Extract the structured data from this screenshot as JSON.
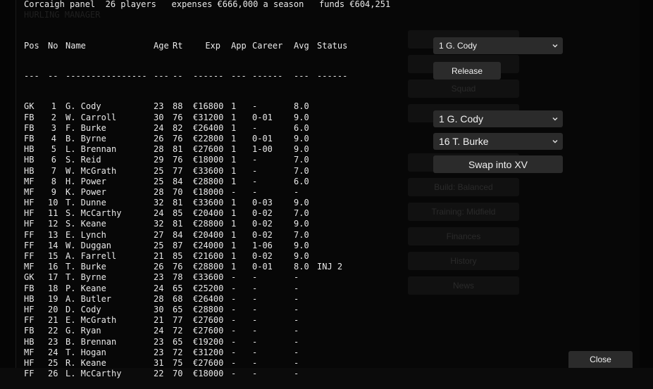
{
  "header": {
    "text": "Corcaigh panel  26 players   expenses €666,000 a season   funds €604,251"
  },
  "table": {
    "columns": {
      "pos": "Pos",
      "no": "No",
      "name": "Name",
      "age": "Age",
      "rt": "Rt",
      "exp": "Exp",
      "app": "App",
      "career": "Career",
      "avg": "Avg",
      "status": "Status"
    },
    "separator": {
      "pos": "---",
      "no": "--",
      "name": "----------------",
      "age": "---",
      "rt": "--",
      "exp": "------",
      "app": "---",
      "career": "------",
      "avg": "---",
      "status": "------"
    },
    "rows": [
      {
        "pos": "GK",
        "no": "1",
        "name": "G. Cody",
        "age": "23",
        "rt": "88",
        "exp": "€16800",
        "app": "1",
        "career": "-",
        "avg": "8.0",
        "status": ""
      },
      {
        "pos": "FB",
        "no": "2",
        "name": "W. Carroll",
        "age": "30",
        "rt": "76",
        "exp": "€31200",
        "app": "1",
        "career": "0-01",
        "avg": "9.0",
        "status": ""
      },
      {
        "pos": "FB",
        "no": "3",
        "name": "F. Burke",
        "age": "24",
        "rt": "82",
        "exp": "€26400",
        "app": "1",
        "career": "-",
        "avg": "6.0",
        "status": ""
      },
      {
        "pos": "FB",
        "no": "4",
        "name": "B. Byrne",
        "age": "26",
        "rt": "76",
        "exp": "€22800",
        "app": "1",
        "career": "0-01",
        "avg": "9.0",
        "status": ""
      },
      {
        "pos": "HB",
        "no": "5",
        "name": "L. Brennan",
        "age": "28",
        "rt": "81",
        "exp": "€27600",
        "app": "1",
        "career": "1-00",
        "avg": "9.0",
        "status": ""
      },
      {
        "pos": "HB",
        "no": "6",
        "name": "S. Reid",
        "age": "29",
        "rt": "76",
        "exp": "€18000",
        "app": "1",
        "career": "-",
        "avg": "7.0",
        "status": ""
      },
      {
        "pos": "HB",
        "no": "7",
        "name": "W. McGrath",
        "age": "25",
        "rt": "77",
        "exp": "€33600",
        "app": "1",
        "career": "-",
        "avg": "7.0",
        "status": ""
      },
      {
        "pos": "MF",
        "no": "8",
        "name": "H. Power",
        "age": "25",
        "rt": "84",
        "exp": "€28800",
        "app": "1",
        "career": "-",
        "avg": "6.0",
        "status": ""
      },
      {
        "pos": "MF",
        "no": "9",
        "name": "K. Power",
        "age": "28",
        "rt": "70",
        "exp": "€18000",
        "app": "-",
        "career": "-",
        "avg": "-",
        "status": ""
      },
      {
        "pos": "HF",
        "no": "10",
        "name": "T. Dunne",
        "age": "32",
        "rt": "81",
        "exp": "€33600",
        "app": "1",
        "career": "0-03",
        "avg": "9.0",
        "status": ""
      },
      {
        "pos": "HF",
        "no": "11",
        "name": "S. McCarthy",
        "age": "24",
        "rt": "85",
        "exp": "€20400",
        "app": "1",
        "career": "0-02",
        "avg": "7.0",
        "status": ""
      },
      {
        "pos": "HF",
        "no": "12",
        "name": "S. Keane",
        "age": "32",
        "rt": "81",
        "exp": "€28800",
        "app": "1",
        "career": "0-02",
        "avg": "9.0",
        "status": ""
      },
      {
        "pos": "FF",
        "no": "13",
        "name": "E. Lynch",
        "age": "27",
        "rt": "84",
        "exp": "€20400",
        "app": "1",
        "career": "0-02",
        "avg": "7.0",
        "status": ""
      },
      {
        "pos": "FF",
        "no": "14",
        "name": "W. Duggan",
        "age": "25",
        "rt": "87",
        "exp": "€24000",
        "app": "1",
        "career": "1-06",
        "avg": "9.0",
        "status": ""
      },
      {
        "pos": "FF",
        "no": "15",
        "name": "A. Farrell",
        "age": "21",
        "rt": "85",
        "exp": "€21600",
        "app": "1",
        "career": "0-02",
        "avg": "9.0",
        "status": ""
      },
      {
        "pos": "MF",
        "no": "16",
        "name": "T. Burke",
        "age": "26",
        "rt": "76",
        "exp": "€28800",
        "app": "1",
        "career": "0-01",
        "avg": "8.0",
        "status": "INJ 2"
      },
      {
        "pos": "GK",
        "no": "17",
        "name": "T. Byrne",
        "age": "23",
        "rt": "78",
        "exp": "€33600",
        "app": "-",
        "career": "-",
        "avg": "-",
        "status": ""
      },
      {
        "pos": "FB",
        "no": "18",
        "name": "P. Keane",
        "age": "24",
        "rt": "65",
        "exp": "€25200",
        "app": "-",
        "career": "-",
        "avg": "-",
        "status": ""
      },
      {
        "pos": "HB",
        "no": "19",
        "name": "A. Butler",
        "age": "28",
        "rt": "68",
        "exp": "€26400",
        "app": "-",
        "career": "-",
        "avg": "-",
        "status": ""
      },
      {
        "pos": "HF",
        "no": "20",
        "name": "D. Cody",
        "age": "30",
        "rt": "65",
        "exp": "€28800",
        "app": "-",
        "career": "-",
        "avg": "-",
        "status": ""
      },
      {
        "pos": "FF",
        "no": "21",
        "name": "E. McGrath",
        "age": "21",
        "rt": "77",
        "exp": "€27600",
        "app": "-",
        "career": "-",
        "avg": "-",
        "status": ""
      },
      {
        "pos": "FB",
        "no": "22",
        "name": "G. Ryan",
        "age": "24",
        "rt": "72",
        "exp": "€27600",
        "app": "-",
        "career": "-",
        "avg": "-",
        "status": ""
      },
      {
        "pos": "HB",
        "no": "23",
        "name": "B. Brennan",
        "age": "23",
        "rt": "65",
        "exp": "€19200",
        "app": "-",
        "career": "-",
        "avg": "-",
        "status": ""
      },
      {
        "pos": "MF",
        "no": "24",
        "name": "T. Hogan",
        "age": "23",
        "rt": "72",
        "exp": "€31200",
        "app": "-",
        "career": "-",
        "avg": "-",
        "status": ""
      },
      {
        "pos": "HF",
        "no": "25",
        "name": "R. Keane",
        "age": "31",
        "rt": "75",
        "exp": "€27600",
        "app": "-",
        "career": "-",
        "avg": "-",
        "status": ""
      },
      {
        "pos": "FF",
        "no": "26",
        "name": "L. McCarthy",
        "age": "22",
        "rt": "70",
        "exp": "€18000",
        "app": "-",
        "career": "-",
        "avg": "-",
        "status": ""
      }
    ]
  },
  "controls": {
    "release_select_value": "1 G. Cody",
    "release_button": "Release",
    "swap_out_select_value": "1 G. Cody",
    "swap_in_select_value": "16 T. Burke",
    "swap_button": "Swap into XV",
    "close_button": "Close"
  },
  "background_ghost": {
    "title": "HURLING MANAGER",
    "menu": [
      "Squad",
      "Build: Balanced",
      "Training: Midfield",
      "Finances",
      "History",
      "News"
    ]
  },
  "colors": {
    "background": "#050505",
    "control": "#2b2b2b",
    "text": "#e9e9e9"
  }
}
